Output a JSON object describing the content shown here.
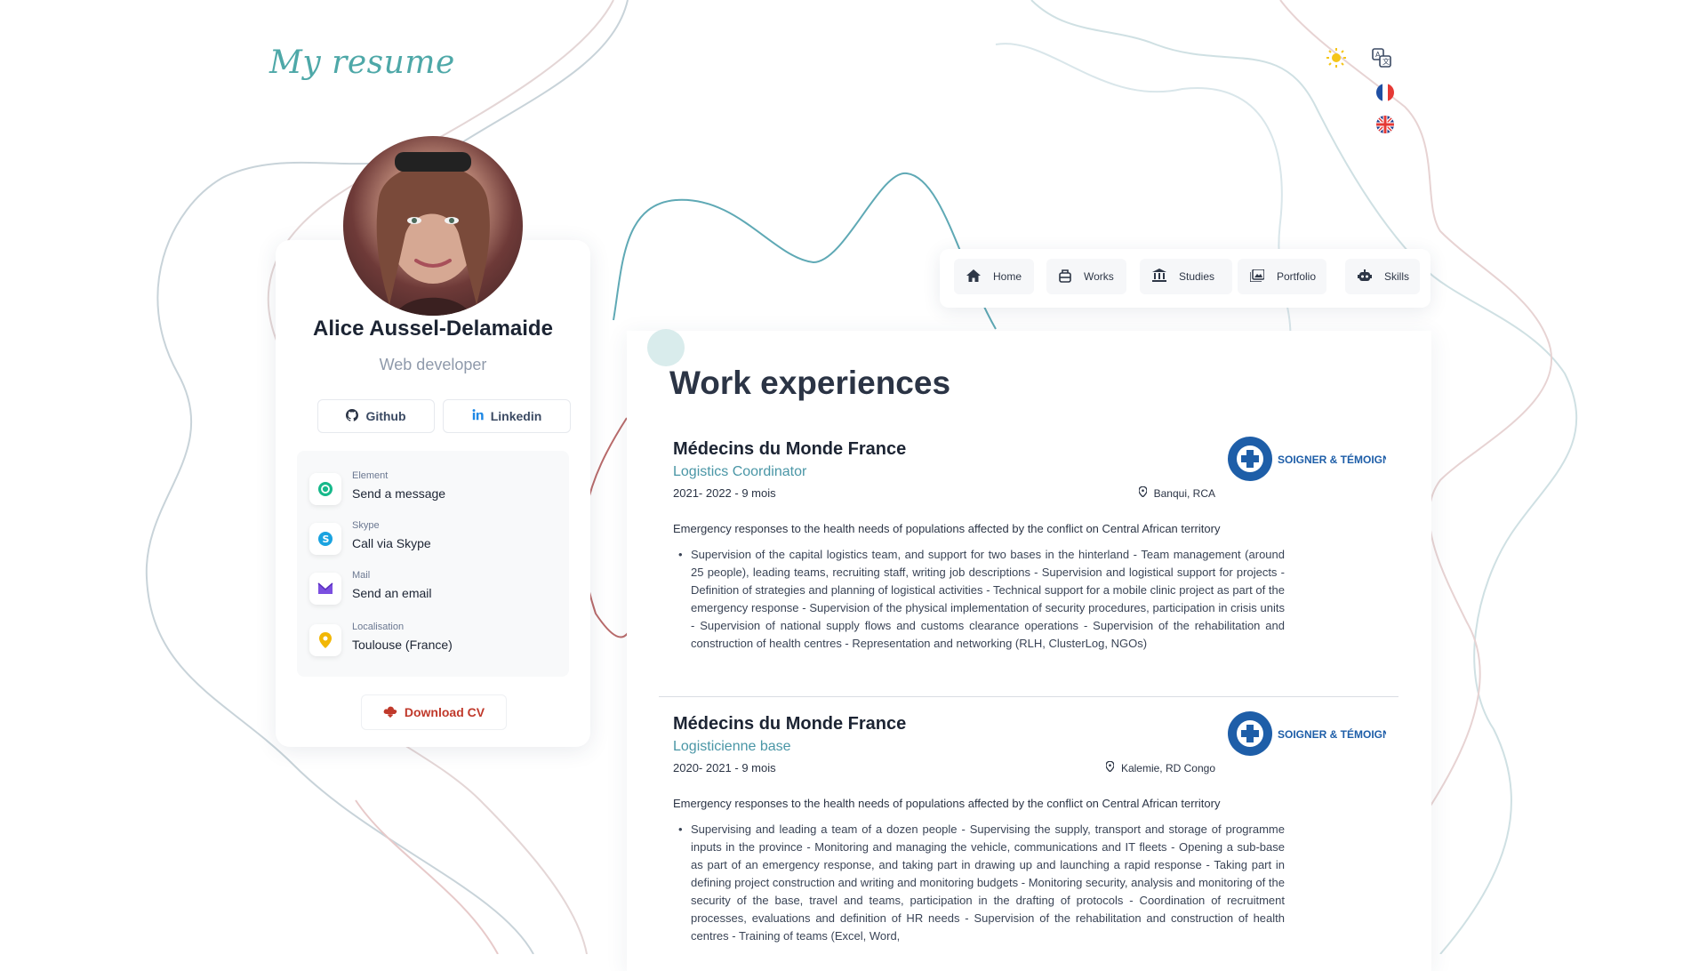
{
  "brand": {
    "title": "My resume"
  },
  "top_icons": [
    "sun-icon",
    "translate-icon",
    "flag-fr-icon",
    "flag-uk-icon"
  ],
  "profile": {
    "name": "Alice Aussel-Delamaide",
    "role": "Web developer",
    "social": [
      {
        "label": "Github",
        "icon": "github-icon"
      },
      {
        "label": "Linkedin",
        "icon": "linkedin-icon"
      }
    ],
    "contacts": [
      {
        "label": "Element",
        "value": "Send a message",
        "icon": "element-icon"
      },
      {
        "label": "Skype",
        "value": "Call via Skype",
        "icon": "skype-icon"
      },
      {
        "label": "Mail",
        "value": "Send an email",
        "icon": "mail-icon"
      },
      {
        "label": "Localisation",
        "value": "Toulouse (France)",
        "icon": "location-pin-icon"
      }
    ],
    "download_label": "Download CV"
  },
  "nav": {
    "items": [
      {
        "label": "Home",
        "icon": "home-icon"
      },
      {
        "label": "Works",
        "icon": "briefcase-icon"
      },
      {
        "label": "Studies",
        "icon": "building-columns-icon"
      },
      {
        "label": "Portfolio",
        "icon": "images-icon"
      },
      {
        "label": "Skills",
        "icon": "robot-icon"
      }
    ]
  },
  "main": {
    "title": "Work experiences",
    "jobs": [
      {
        "org": "Médecins du Monde France",
        "role": "Logistics Coordinator",
        "period": "2021- 2022 - 9 mois",
        "location": "Banqui, RCA",
        "logo_text": "SOIGNER & TÉMOIGNER",
        "summary": "Emergency responses to the health needs of populations affected by the conflict on Central African territory",
        "details": "Supervision of the capital logistics team, and support for two bases in the hinterland - Team management (around 25 people), leading teams, recruiting staff, writing job descriptions - Supervision and logistical support for projects - Definition of strategies and planning of logistical activities - Technical support for a mobile clinic project as part of the emergency response - Supervision of the physical implementation of security procedures, participation in crisis units - Supervision of national supply flows and customs clearance operations - Supervision of the rehabilitation and construction of health centres - Representation and networking (RLH, ClusterLog, NGOs)"
      },
      {
        "org": "Médecins du Monde France",
        "role": "Logisticienne base",
        "period": "2020- 2021 - 9 mois",
        "location": "Kalemie, RD Congo",
        "logo_text": "SOIGNER & TÉMOIGNER",
        "summary": "Emergency responses to the health needs of populations affected by the conflict on Central African territory",
        "details": "Supervising and leading a team of a dozen people - Supervising the supply, transport and storage of programme inputs in the province - Monitoring and managing the vehicle, communications and IT fleets - Opening a sub-base as part of an emergency response, and taking part in drawing up and launching a rapid response - Taking part in defining project construction and writing and monitoring budgets - Monitoring security, analysis and monitoring of the security of the base, travel and teams, participation in the drafting of protocols - Coordination of recruitment processes, evaluations and definition of HR needs - Supervision of the rehabilitation and construction of health centres - Training of teams (Excel, Word,"
      }
    ]
  },
  "colors": {
    "accent": "#4a96a6",
    "brand": "#4ea8a8",
    "download": "#c0392b"
  }
}
